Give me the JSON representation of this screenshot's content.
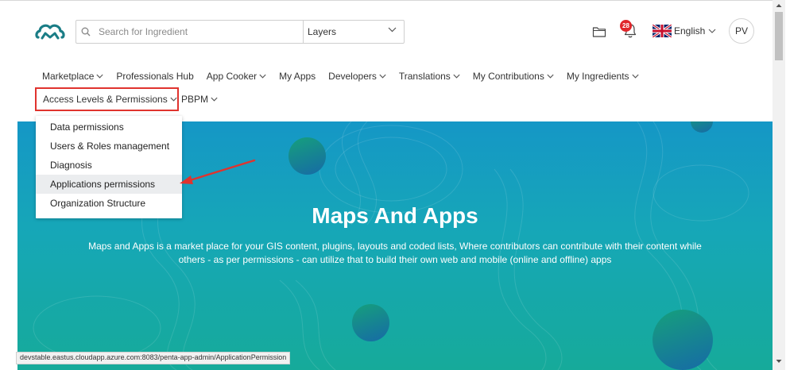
{
  "header": {
    "search": {
      "placeholder": "Search for Ingredient"
    },
    "layer_select": {
      "value": "Layers"
    },
    "notifications": {
      "count": "28"
    },
    "language": {
      "label": "English"
    },
    "user": {
      "initials": "PV"
    }
  },
  "nav": {
    "items": [
      {
        "label": "Marketplace",
        "dropdown": true
      },
      {
        "label": "Professionals Hub",
        "dropdown": false
      },
      {
        "label": "App Cooker",
        "dropdown": true
      },
      {
        "label": "My Apps",
        "dropdown": false
      },
      {
        "label": "Developers",
        "dropdown": true
      },
      {
        "label": "Translations",
        "dropdown": true
      },
      {
        "label": "My Contributions",
        "dropdown": true
      },
      {
        "label": "My Ingredients",
        "dropdown": true
      }
    ],
    "access": {
      "label": "Access Levels & Permissions"
    },
    "pbpm": {
      "label": "PBPM"
    }
  },
  "dropdown": {
    "items": [
      {
        "label": "Data permissions"
      },
      {
        "label": "Users & Roles management"
      },
      {
        "label": "Diagnosis"
      },
      {
        "label": "Applications permissions",
        "highlighted": true
      },
      {
        "label": "Organization Structure"
      }
    ]
  },
  "hero": {
    "title": "Maps And Apps",
    "description": "Maps and Apps is a market place for your GIS content, plugins, layouts and coded lists, Where contributors can contribute with their content while others - as per permissions - can utilize that to build their own web and mobile (online and offline) apps"
  },
  "status_bar": {
    "url": "devstable.eastus.cloudapp.azure.com:8083/penta-app-admin/ApplicationPermission"
  },
  "colors": {
    "accent_red": "#e0332e",
    "hero_top": "#1597c6",
    "hero_bottom": "#16aa9a",
    "badge": "#e0262b",
    "logo": "#1a7d86"
  },
  "icons": [
    "cloud-logo-icon",
    "search-icon",
    "chevron-down-icon",
    "folder-icon",
    "bell-icon",
    "uk-flag-icon",
    "red-arrow-annotation"
  ]
}
